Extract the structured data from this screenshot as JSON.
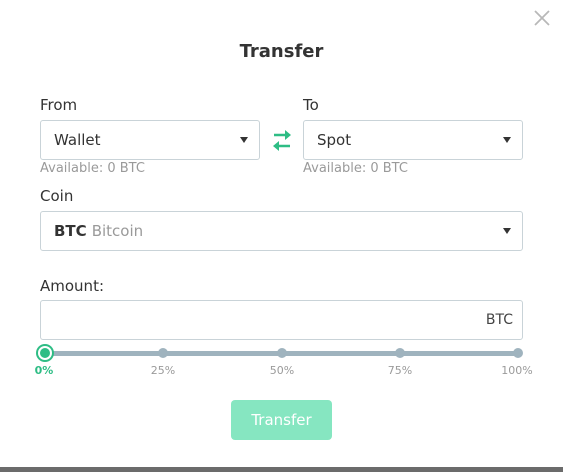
{
  "dialog": {
    "title": "Transfer",
    "close_icon": "close-icon"
  },
  "from": {
    "label": "From",
    "value": "Wallet",
    "available": "Available: 0 BTC"
  },
  "to": {
    "label": "To",
    "value": "Spot",
    "available": "Available: 0 BTC"
  },
  "swap_icon": "swap-arrows-icon",
  "coin": {
    "label": "Coin",
    "code": "BTC",
    "name": "Bitcoin"
  },
  "amount": {
    "label": "Amount:",
    "value": "",
    "placeholder": "",
    "unit": "BTC"
  },
  "slider": {
    "value_percent": 0,
    "ticks": [
      "0%",
      "25%",
      "50%",
      "75%",
      "100%"
    ]
  },
  "submit_label": "Transfer",
  "colors": {
    "accent": "#2ebd85",
    "button_disabled": "#86e6c1",
    "track": "#9fb3be"
  }
}
